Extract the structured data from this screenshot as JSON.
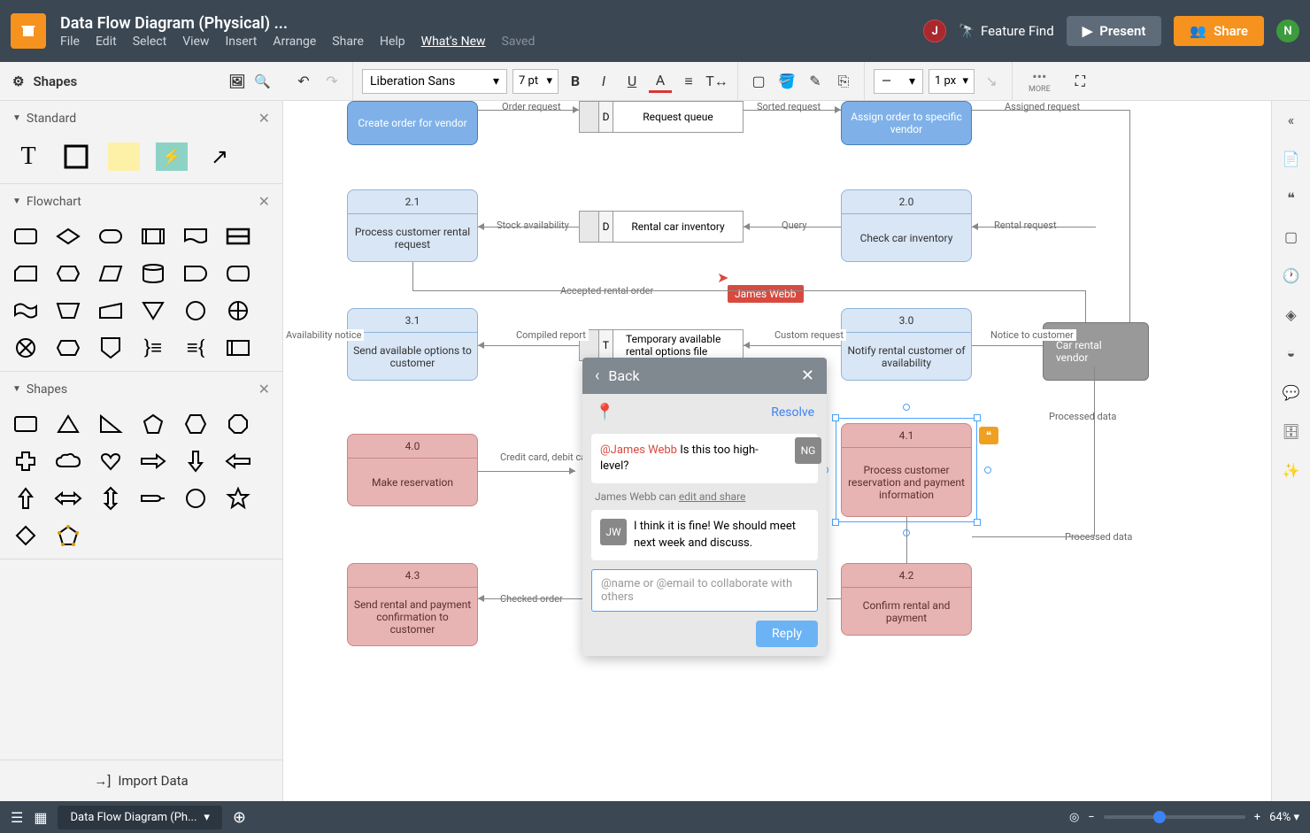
{
  "header": {
    "title": "Data Flow Diagram (Physical) ...",
    "menu": {
      "file": "File",
      "edit": "Edit",
      "select": "Select",
      "view": "View",
      "insert": "Insert",
      "arrange": "Arrange",
      "share": "Share",
      "help": "Help",
      "whatsnew": "What's New",
      "saved": "Saved"
    },
    "feature_find": "Feature Find",
    "present": "Present",
    "share_btn": "Share",
    "avatar_j": "J",
    "avatar_n": "N"
  },
  "toolbar": {
    "shapes_label": "Shapes",
    "font": "Liberation Sans",
    "pt": "7 pt",
    "px": "1 px",
    "more": "MORE"
  },
  "left": {
    "sections": {
      "standard": "Standard",
      "flowchart": "Flowchart",
      "shapes": "Shapes"
    },
    "import": "Import Data"
  },
  "canvas": {
    "nodes": {
      "create_order": {
        "num": "",
        "txt": "Create order for vendor"
      },
      "assign_order": {
        "num": "",
        "txt": "Assign order to specific vendor"
      },
      "n21": {
        "num": "2.1",
        "txt": "Process customer rental request"
      },
      "n20": {
        "num": "2.0",
        "txt": "Check car inventory"
      },
      "n31": {
        "num": "3.1",
        "txt": "Send available options to customer"
      },
      "n30": {
        "num": "3.0",
        "txt": "Notify rental customer of availability"
      },
      "n40": {
        "num": "4.0",
        "txt": "Make reservation"
      },
      "n41": {
        "num": "4.1",
        "txt": "Process customer reservation and payment information"
      },
      "n43": {
        "num": "4.3",
        "txt": "Send rental and payment confirmation to customer"
      },
      "n42": {
        "num": "4.2",
        "txt": "Confirm rental and payment"
      }
    },
    "datastores": {
      "request_queue": {
        "letter": "D",
        "txt": "Request queue"
      },
      "inventory": {
        "letter": "D",
        "txt": "Rental car inventory"
      },
      "temp": {
        "letter": "T",
        "txt": "Temporary available rental options file"
      }
    },
    "vendor": "Car rental vendor",
    "edges": {
      "order_request": "Order request",
      "sorted_request": "Sorted request",
      "assigned_request": "Assigned request",
      "stock": "Stock availability",
      "query": "Query",
      "rental_request": "Rental request",
      "accepted": "Accepted rental order",
      "availability": "Availability notice",
      "compiled": "Compiled report",
      "custom": "Custom request",
      "notice": "Notice to customer",
      "processed": "Processed data",
      "processed2": "Processed data",
      "credit": "Credit card, debit card, or cash",
      "checked": "Checked order"
    },
    "cursor_user": "James Webb"
  },
  "comment": {
    "back": "Back",
    "resolve": "Resolve",
    "msg1_mention": "@James Webb",
    "msg1_text": " Is this too high-level?",
    "msg1_av": "NG",
    "perm_user": "James Webb can ",
    "perm_link": "edit and share",
    "msg2_av": "JW",
    "msg2_text": "I think it is fine! We should meet next week and discuss.",
    "placeholder": "@name or @email to collaborate with others",
    "reply": "Reply"
  },
  "bottom": {
    "tab": "Data Flow Diagram (Ph...",
    "zoom": "64%"
  }
}
